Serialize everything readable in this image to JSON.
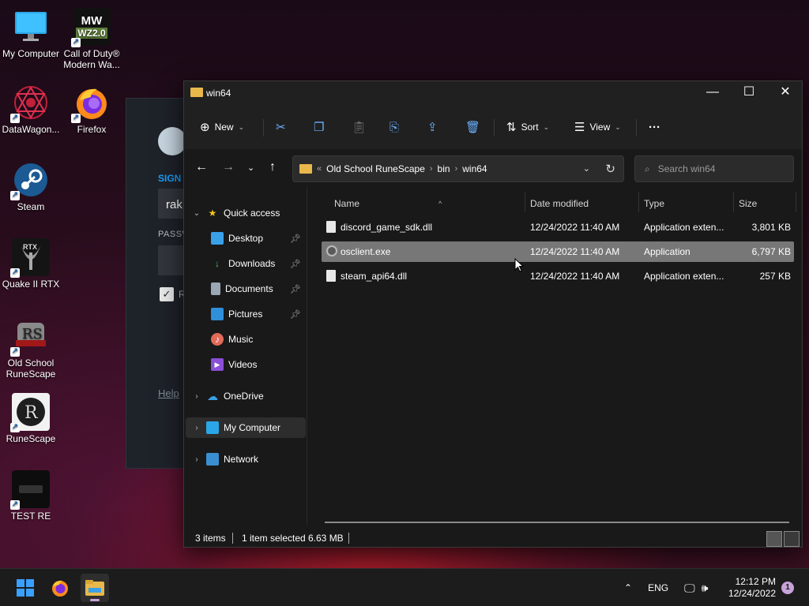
{
  "desktop": {
    "icons": [
      {
        "label": "My Computer",
        "label2": ""
      },
      {
        "label": "Call of Duty®",
        "label2": "Modern Wa..."
      },
      {
        "label": "DataWagon...",
        "label2": ""
      },
      {
        "label": "Firefox",
        "label2": ""
      },
      {
        "label": "Steam",
        "label2": ""
      },
      {
        "label": "Quake II RTX",
        "label2": ""
      },
      {
        "label": "Old School",
        "label2": "RuneScape"
      },
      {
        "label": "RuneScape",
        "label2": ""
      },
      {
        "label": "TEST RE",
        "label2": ""
      }
    ],
    "cod_badge_top": "MW",
    "cod_badge_bottom": "WZ2.0",
    "rtx_text": "RTX"
  },
  "steam_window": {
    "sign_in_label": "SIGN",
    "username_partial": "rak",
    "password_label": "PASSW",
    "remember_partial": "R",
    "help_partial": "Help"
  },
  "explorer": {
    "title": "win64",
    "toolbar": {
      "new_label": "New",
      "sort_label": "Sort",
      "view_label": "View",
      "more_label": "···"
    },
    "breadcrumb": [
      "Old School RuneScape",
      "bin",
      "win64"
    ],
    "search_placeholder": "Search win64",
    "nav": {
      "quick_access": "Quick access",
      "desktop": "Desktop",
      "downloads": "Downloads",
      "documents": "Documents",
      "pictures": "Pictures",
      "music": "Music",
      "videos": "Videos",
      "onedrive": "OneDrive",
      "my_computer": "My Computer",
      "network": "Network"
    },
    "columns": {
      "name": "Name",
      "date": "Date modified",
      "type": "Type",
      "size": "Size"
    },
    "files": [
      {
        "name": "discord_game_sdk.dll",
        "date": "12/24/2022 11:40 AM",
        "type": "Application exten...",
        "size": "3,801 KB"
      },
      {
        "name": "osclient.exe",
        "date": "12/24/2022 11:40 AM",
        "type": "Application",
        "size": "6,797 KB"
      },
      {
        "name": "steam_api64.dll",
        "date": "12/24/2022 11:40 AM",
        "type": "Application exten...",
        "size": "257 KB"
      }
    ],
    "status": {
      "items": "3 items",
      "selected": "1 item selected",
      "size": "6.63 MB"
    }
  },
  "taskbar": {
    "lang": "ENG",
    "time": "12:12 PM",
    "date": "12/24/2022",
    "notification_count": "1"
  }
}
